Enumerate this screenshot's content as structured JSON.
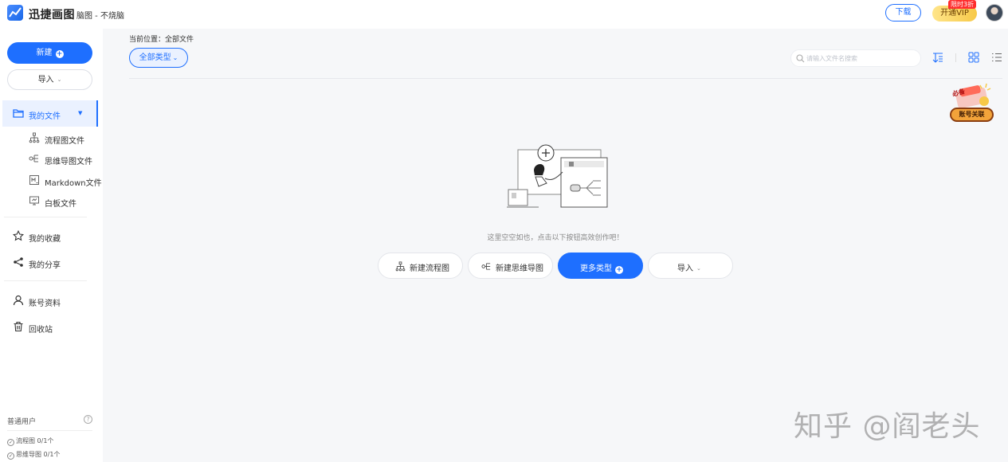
{
  "header": {
    "app_name": "迅捷画图",
    "doc_title": "脑图 - 不烧脑",
    "download_label": "下载",
    "vip_label": "开通VIP",
    "vip_badge": "限时3折"
  },
  "sidebar": {
    "new_label": "新建",
    "import_label": "导入",
    "my_files": "我的文件",
    "sub_items": [
      {
        "label": "流程图文件",
        "icon": "flowchart-icon"
      },
      {
        "label": "思维导图文件",
        "icon": "mindmap-icon"
      },
      {
        "label": "Markdown文件",
        "icon": "markdown-icon"
      },
      {
        "label": "白板文件",
        "icon": "whiteboard-icon"
      }
    ],
    "favorites": "我的收藏",
    "shared": "我的分享",
    "account": "账号资料",
    "trash": "回收站",
    "user_type": "普通用户",
    "quota": [
      {
        "label": "流程图 0/1个"
      },
      {
        "label": "思维导图 0/1个"
      }
    ]
  },
  "main": {
    "breadcrumb": "当前位置：全部文件",
    "filter_label": "全部类型",
    "search_placeholder": "请输入文件名搜索",
    "promo_label": "账号关联",
    "promo_tag": "必备",
    "empty_text": "这里空空如也，点击以下按钮高效创作吧！",
    "actions": {
      "new_flowchart": "新建流程图",
      "new_mindmap": "新建思维导图",
      "more_types": "更多类型",
      "import": "导入"
    }
  },
  "watermark": "知乎 @阎老头",
  "colors": {
    "accent": "#1e6fff",
    "vip": "#f7c948",
    "background": "#f6f7f9"
  }
}
